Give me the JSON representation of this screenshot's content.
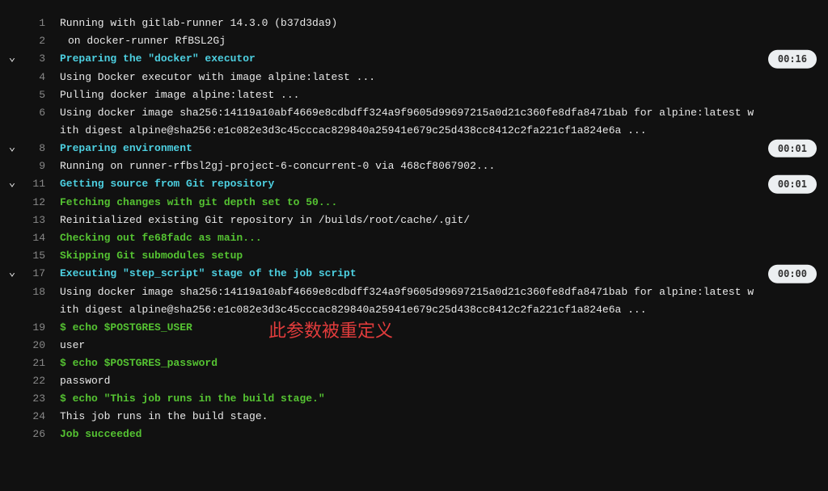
{
  "lines": [
    {
      "n": "1",
      "text": "Running with gitlab-runner 14.3.0 (b37d3da9)"
    },
    {
      "n": "2",
      "text": "on docker-runner RfBSL2Gj",
      "indent": true
    },
    {
      "n": "3",
      "text": "Preparing the \"docker\" executor",
      "chevron": true,
      "cls": "section-header",
      "badge": "00:16"
    },
    {
      "n": "4",
      "text": "Using Docker executor with image alpine:latest ..."
    },
    {
      "n": "5",
      "text": "Pulling docker image alpine:latest ..."
    },
    {
      "n": "6",
      "text": "Using docker image sha256:14119a10abf4669e8cdbdff324a9f9605d99697215a0d21c360fe8dfa8471bab for alpine:latest with digest alpine@sha256:e1c082e3d3c45cccac829840a25941e679c25d438cc8412c2fa221cf1a824e6a ..."
    },
    {
      "n": "8",
      "text": "Preparing environment",
      "chevron": true,
      "cls": "section-header",
      "badge": "00:01"
    },
    {
      "n": "9",
      "text": "Running on runner-rfbsl2gj-project-6-concurrent-0 via 468cf8067902..."
    },
    {
      "n": "11",
      "text": "Getting source from Git repository",
      "chevron": true,
      "cls": "section-header",
      "badge": "00:01"
    },
    {
      "n": "12",
      "text": "Fetching changes with git depth set to 50...",
      "cls": "green"
    },
    {
      "n": "13",
      "text": "Reinitialized existing Git repository in /builds/root/cache/.git/"
    },
    {
      "n": "14",
      "text": "Checking out fe68fadc as main...",
      "cls": "green"
    },
    {
      "n": "15",
      "text": "Skipping Git submodules setup",
      "cls": "green"
    },
    {
      "n": "17",
      "text": "Executing \"step_script\" stage of the job script",
      "chevron": true,
      "cls": "section-header",
      "badge": "00:00"
    },
    {
      "n": "18",
      "text": "Using docker image sha256:14119a10abf4669e8cdbdff324a9f9605d99697215a0d21c360fe8dfa8471bab for alpine:latest with digest alpine@sha256:e1c082e3d3c45cccac829840a25941e679c25d438cc8412c2fa221cf1a824e6a ..."
    },
    {
      "n": "19",
      "text": "$ echo $POSTGRES_USER",
      "cls": "green-normal",
      "annot": true
    },
    {
      "n": "20",
      "text": "user"
    },
    {
      "n": "21",
      "text": "$ echo $POSTGRES_password",
      "cls": "green-normal"
    },
    {
      "n": "22",
      "text": "password"
    },
    {
      "n": "23",
      "text": "$ echo \"This job runs in the build stage.\"",
      "cls": "green-normal"
    },
    {
      "n": "24",
      "text": "This job runs in the build stage."
    },
    {
      "n": "26",
      "text": "Job succeeded",
      "cls": "green-normal"
    }
  ],
  "annotation": "此参数被重定义",
  "icons": {
    "chevron_down": "⌄"
  }
}
